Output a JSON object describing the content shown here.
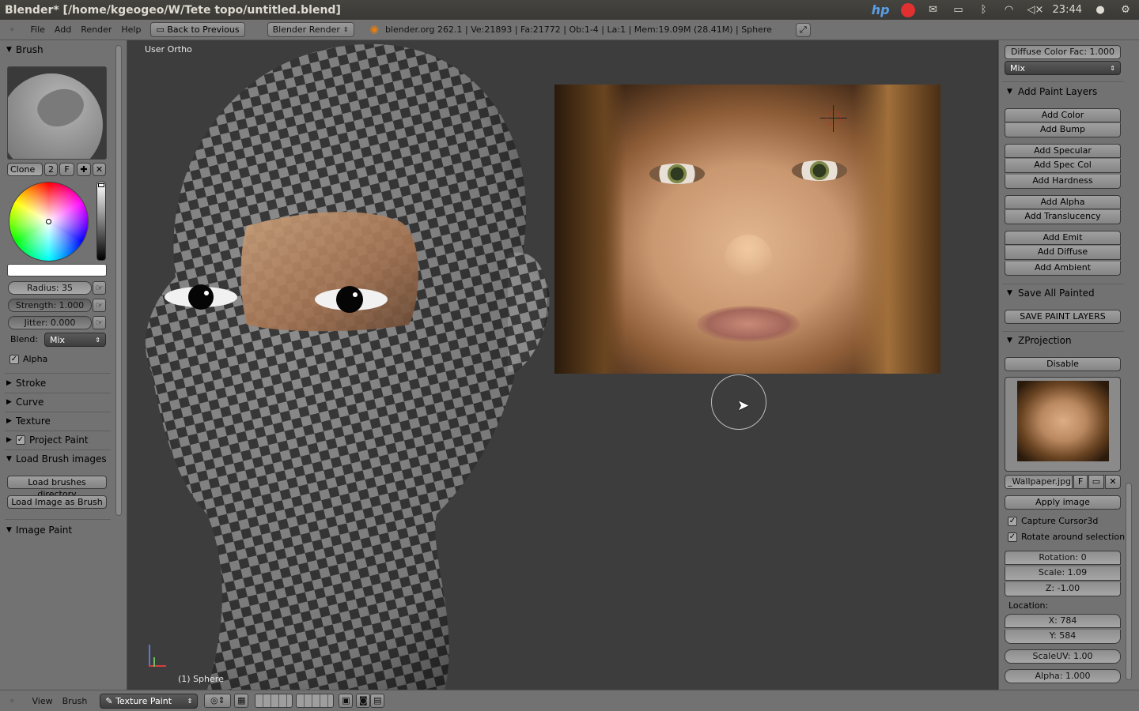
{
  "os": {
    "window_title": "Blender* [/home/kgeogeo/W/Tete topo/untitled.blend]",
    "time": "23:44",
    "icons": [
      "hp-icon",
      "record-icon",
      "mail-icon",
      "battery-icon",
      "bluetooth-icon",
      "wifi-icon",
      "volume-icon",
      "user-icon",
      "gear-icon"
    ]
  },
  "info": {
    "menus": [
      "File",
      "Add",
      "Render",
      "Help"
    ],
    "back_button": "Back to Previous",
    "render_engine": "Blender Render",
    "stats": "blender.org 262.1 | Ve:21893 | Fa:21772 | Ob:1-4 | La:1 | Mem:19.09M (28.41M) | Sphere"
  },
  "left": {
    "brush_header": "Brush",
    "brush_name": "Clone",
    "brush_users": "2",
    "brush_fake": "F",
    "radius": "Radius: 35",
    "strength": "Strength: 1.000",
    "jitter": "Jitter: 0.000",
    "blend_label": "Blend:",
    "blend_value": "Mix",
    "alpha_label": "Alpha",
    "sections": [
      "Stroke",
      "Curve",
      "Texture",
      "Project Paint",
      "Load Brush images"
    ],
    "load_brushes_dir": "Load brushes directory",
    "load_image_as_brush": "Load Image as Brush",
    "image_paint_header": "Image Paint"
  },
  "viewport": {
    "view_label": "User Ortho",
    "object_label": "(1) Sphere"
  },
  "right": {
    "diffuse_color_fac": "Diffuse Color Fac: 1.000",
    "mix_value": "Mix",
    "add_paint_layers_header": "Add Paint Layers",
    "paint_buttons": [
      [
        "Add Color",
        "Add Bump"
      ],
      [
        "Add Specular",
        "Add Spec Col",
        "Add Hardness"
      ],
      [
        "Add Alpha",
        "Add Translucency"
      ],
      [
        "Add Emit",
        "Add Diffuse",
        "Add Ambient"
      ]
    ],
    "save_all_painted_header": "Save All Painted",
    "save_paint_layers": "SAVE PAINT LAYERS",
    "zprojection_header": "ZProjection",
    "disable_button": "Disable",
    "image_name": "_Wallpaper.jpg",
    "image_fake": "F",
    "apply_image": "Apply image",
    "capture_cursor": "Capture Cursor3d",
    "rotate_around": "Rotate around selection",
    "rotation": "Rotation: 0",
    "scale": "Scale: 1.09",
    "z": "Z: -1.00",
    "location_label": "Location:",
    "x": "X: 784",
    "y": "Y: 584",
    "scale_uv": "ScaleUV: 1.00",
    "alpha": "Alpha: 1.000"
  },
  "bottom": {
    "menus": [
      "View",
      "Brush"
    ],
    "mode": "Texture Paint"
  }
}
